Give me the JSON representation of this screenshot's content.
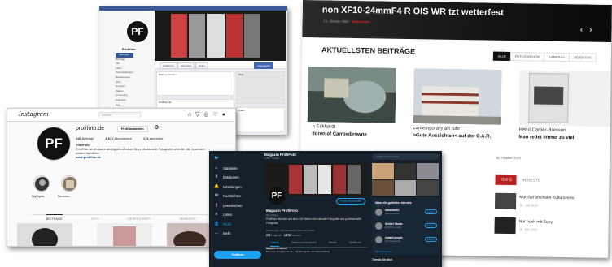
{
  "website": {
    "hero_title": "non XF10-24mmF4 R OIS WR  tzt wetterfest",
    "hero_sub": "18. Oktober 2020",
    "hero_link": "Weiterlesen",
    "section_title": "AKTUELLSTEN BEITRÄGE",
    "filters": [
      "ALLE",
      "FOTOZUBEHÖR",
      "KAMERAS",
      "OBJEKTIVE"
    ],
    "cards": [
      {
        "line1": "n Eckhardt",
        "line2": "ildren of Carrowbrowne"
      },
      {
        "line1": "contemporary art ruhr",
        "line2": ">Gute Aussichten< auf der C.A.R."
      },
      {
        "line1": "Henri Cartier-Bresson",
        "line2": "Man redet immer zu viel"
      }
    ],
    "date_label": "16. Oktober 2020",
    "tabs": [
      "TOP 5",
      "NEUESTE"
    ],
    "top_items": [
      {
        "title": "Morcfall erscheint Kulturszene",
        "date": "28. Juli 2020"
      },
      {
        "title": "Nur noch mit Sony",
        "date": "29. Juli 2020"
      }
    ]
  },
  "facebook": {
    "logo": "PF",
    "page_name": "Profifoto",
    "nav_items": [
      "Startseite",
      "Beiträge",
      "Info",
      "Fotos",
      "Veranstaltungen",
      "Bewertungen",
      "Jobs",
      "Gruppen",
      "Videos",
      "Community",
      "Angebote",
      "Live"
    ],
    "active_nav": "Startseite",
    "buttons": [
      "Gefällt mir",
      "Abonniert",
      "Teilen",
      "Jetzt kaufen"
    ],
    "panels": [
      "Beitrag erstellen",
      "Über",
      "Fotos"
    ],
    "lines": [
      "Profifoto.de",
      "Beitrag erstellen"
    ]
  },
  "instagram": {
    "logo": "Instagram",
    "search_placeholder": "Suchen",
    "icons": [
      "⌂",
      "▽",
      "◎",
      "♡",
      "●"
    ],
    "avatar": "PF",
    "username": "profifoto.de",
    "edit_label": "Profil bearbeiten",
    "gear": "⚙",
    "stats": [
      {
        "num": "116",
        "label": "Beiträge"
      },
      {
        "num": "1.617",
        "label": "Abonnenten"
      },
      {
        "num": "174",
        "label": "abonniert"
      }
    ],
    "bio_name": "ProfiFoto",
    "bio_text": "ProfiFoto ist deutschs wichtigstes Medium für professionelle Fotografen und die, die es werden wollen. #profifoto",
    "bio_link": "www.profifoto.de",
    "highlights": [
      "Highlights",
      "Neuzuba..."
    ],
    "tabs": [
      "BEITRÄGE",
      "IGTV",
      "GESPEICHERT",
      "MARKIERT"
    ]
  },
  "twitter": {
    "nav_items": [
      {
        "icon": "🐦",
        "label": ""
      },
      {
        "icon": "⌂",
        "label": "Startseite"
      },
      {
        "icon": "#",
        "label": "Entdecken"
      },
      {
        "icon": "🔔",
        "label": "Mitteilungen"
      },
      {
        "icon": "✉",
        "label": "Nachrichten"
      },
      {
        "icon": "▯",
        "label": "Lesezeichen"
      },
      {
        "icon": "≡",
        "label": "Listen"
      },
      {
        "icon": "👤",
        "label": "Profil"
      },
      {
        "icon": "…",
        "label": "Mehr"
      }
    ],
    "active_nav": "Profil",
    "tweet_button": "Twittern",
    "header_name": "Magazin ProfiFoto",
    "header_sub": "2.867 Tweets",
    "avatar": "PF",
    "edit_label": "Profil bearbeiten",
    "name": "Magazin ProfiFoto",
    "handle": "@profifoto",
    "bio": "ProfiFoto berichtet seit über 100 Heften über aktuelle Fotografie und professionelle Fotografie.",
    "meta": "profifoto.de · Seit Dezember 2010 bei Twitter",
    "following": "375",
    "following_label": "Folge ich",
    "followers": "2.678",
    "followers_label": "Follower",
    "tabs": [
      "Tweets",
      "Tweets und Antworten",
      "Medien",
      "Gefällt mir"
    ],
    "tweet_author": "Magazin ProfiFoto",
    "tweet_text": "Die neue Ausgabe ist da – mit Fotografie aus Deutschland.",
    "search_placeholder": "Twitter durchsuchen",
    "who_to_follow": "Was dir gefallen könnte",
    "suggestions": [
      {
        "name": "aimsstart01",
        "handle": "@aimsstart01"
      },
      {
        "name": "Schlart Studio",
        "handle": "@schlart_studio"
      },
      {
        "name": "instant people",
        "handle": "@instantpeople"
      }
    ],
    "follow_label": "Folgen",
    "show_more": "Mehr anzeigen",
    "trends": "Trends für dich"
  }
}
